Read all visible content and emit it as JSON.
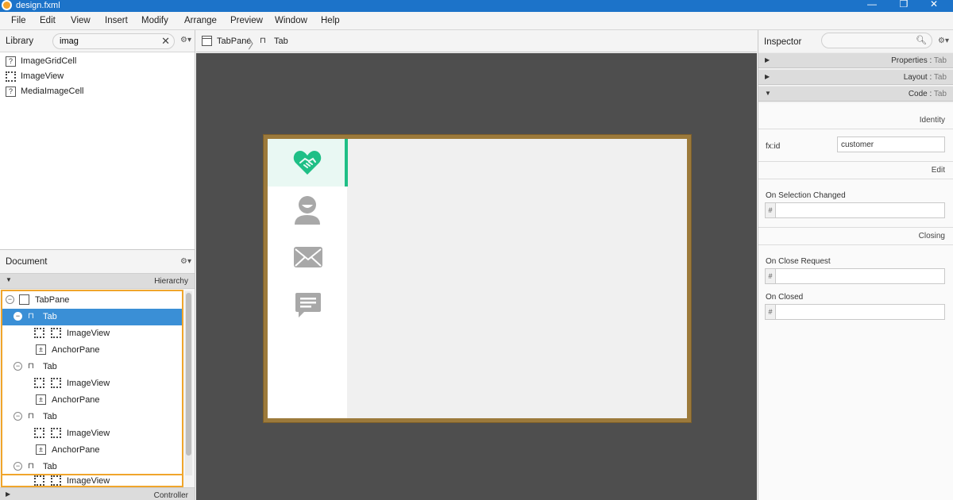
{
  "window": {
    "title": "design.fxml",
    "minimize_glyph": "—",
    "restore_glyph": "❐",
    "close_glyph": "✕"
  },
  "menu": [
    "File",
    "Edit",
    "View",
    "Insert",
    "Modify",
    "Arrange",
    "Preview",
    "Window",
    "Help"
  ],
  "library": {
    "title": "Library",
    "search_value": "imag",
    "items": [
      {
        "label": "ImageGridCell",
        "icon": "unknown-component-icon"
      },
      {
        "label": "ImageView",
        "icon": "imageview-icon"
      },
      {
        "label": "MediaImageCell",
        "icon": "unknown-component-icon"
      }
    ]
  },
  "document": {
    "title": "Document",
    "hierarchy_label": "Hierarchy",
    "controller_label": "Controller",
    "tree": [
      {
        "label": "TabPane",
        "type": "tabpane",
        "toggle": "−",
        "depth": 0
      },
      {
        "label": "Tab",
        "type": "tab",
        "toggle": "−",
        "depth": 1,
        "selected": true
      },
      {
        "label": "ImageView",
        "type": "imageview",
        "depth": 2
      },
      {
        "label": "AnchorPane",
        "type": "anchorpane",
        "depth": 2
      },
      {
        "label": "Tab",
        "type": "tab",
        "toggle": "−",
        "depth": 1
      },
      {
        "label": "ImageView",
        "type": "imageview",
        "depth": 2
      },
      {
        "label": "AnchorPane",
        "type": "anchorpane",
        "depth": 2
      },
      {
        "label": "Tab",
        "type": "tab",
        "toggle": "−",
        "depth": 1
      },
      {
        "label": "ImageView",
        "type": "imageview",
        "depth": 2
      },
      {
        "label": "AnchorPane",
        "type": "anchorpane",
        "depth": 2
      },
      {
        "label": "Tab",
        "type": "tab",
        "toggle": "−",
        "depth": 1
      },
      {
        "label": "ImageView",
        "type": "imageview",
        "depth": 2
      }
    ]
  },
  "breadcrumb": {
    "root": "TabPane",
    "current": "Tab"
  },
  "preview": {
    "tabs": [
      {
        "icon": "handshake-heart-icon",
        "active": true
      },
      {
        "icon": "user-icon",
        "active": false
      },
      {
        "icon": "mail-icon",
        "active": false
      },
      {
        "icon": "chat-icon",
        "active": false
      }
    ],
    "accent": "#1fbf86",
    "frame_color": "#9c7a3b"
  },
  "inspector": {
    "title": "Inspector",
    "sections": [
      {
        "name": "Properties",
        "suffix": "Tab",
        "expanded": false
      },
      {
        "name": "Layout",
        "suffix": "Tab",
        "expanded": false
      },
      {
        "name": "Code",
        "suffix": "Tab",
        "expanded": true
      }
    ],
    "identity": {
      "group": "Identity",
      "fx_id_label": "fx:id",
      "fx_id_value": "customer"
    },
    "edit": {
      "group": "Edit",
      "on_selection_changed_label": "On Selection Changed",
      "on_selection_changed_value": ""
    },
    "closing": {
      "group": "Closing",
      "on_close_request_label": "On Close Request",
      "on_close_request_value": "",
      "on_closed_label": "On Closed",
      "on_closed_value": ""
    },
    "hash": "#"
  }
}
